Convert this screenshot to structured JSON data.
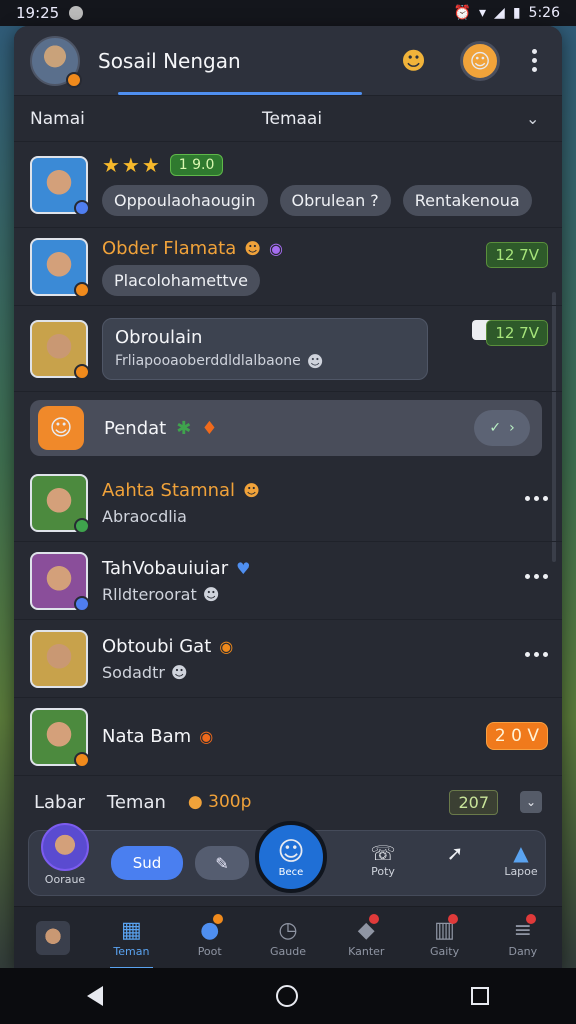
{
  "status_bar": {
    "time": "19:25",
    "right_time": "5:26"
  },
  "header": {
    "title": "Sosail Nengan"
  },
  "subheader": {
    "left": "Namai",
    "middle": "Temaai"
  },
  "items": [
    {
      "stars": "★★★",
      "score": "1 9.0",
      "chips": [
        "Oppoulaohaougin",
        "Obrulean ?",
        "Rentakenoua"
      ]
    },
    {
      "name": "Obder Flamata",
      "sub": "Placolohamettve",
      "badge": "12 7V"
    },
    {
      "name": "Obroulain",
      "sub": "Frliapooaoberddldlalbaone",
      "badge": "12 7V"
    },
    {
      "name": "Pendat"
    },
    {
      "name": "Aahta Stamnal",
      "sub": "Abraocdlia"
    },
    {
      "name": "TahVobauiuiar",
      "sub": "Rlldteroorat"
    },
    {
      "name": "Obtoubi Gat",
      "sub": "Sodadtr"
    },
    {
      "name": "Nata Bam",
      "badge": "2 0 V"
    }
  ],
  "labar": {
    "left": "Labar",
    "mid": "Teman",
    "coin": "300p",
    "pill": "207"
  },
  "actionbar": {
    "me": "Ooraue",
    "sud": "Sud",
    "center": "Bece",
    "a1": "Poty",
    "a3": "Lapoe"
  },
  "bottom_nav": [
    {
      "label": ""
    },
    {
      "label": "Teman"
    },
    {
      "label": "Poot"
    },
    {
      "label": "Gaude"
    },
    {
      "label": "Kanter"
    },
    {
      "label": "Gaity"
    },
    {
      "label": "Dany"
    }
  ]
}
